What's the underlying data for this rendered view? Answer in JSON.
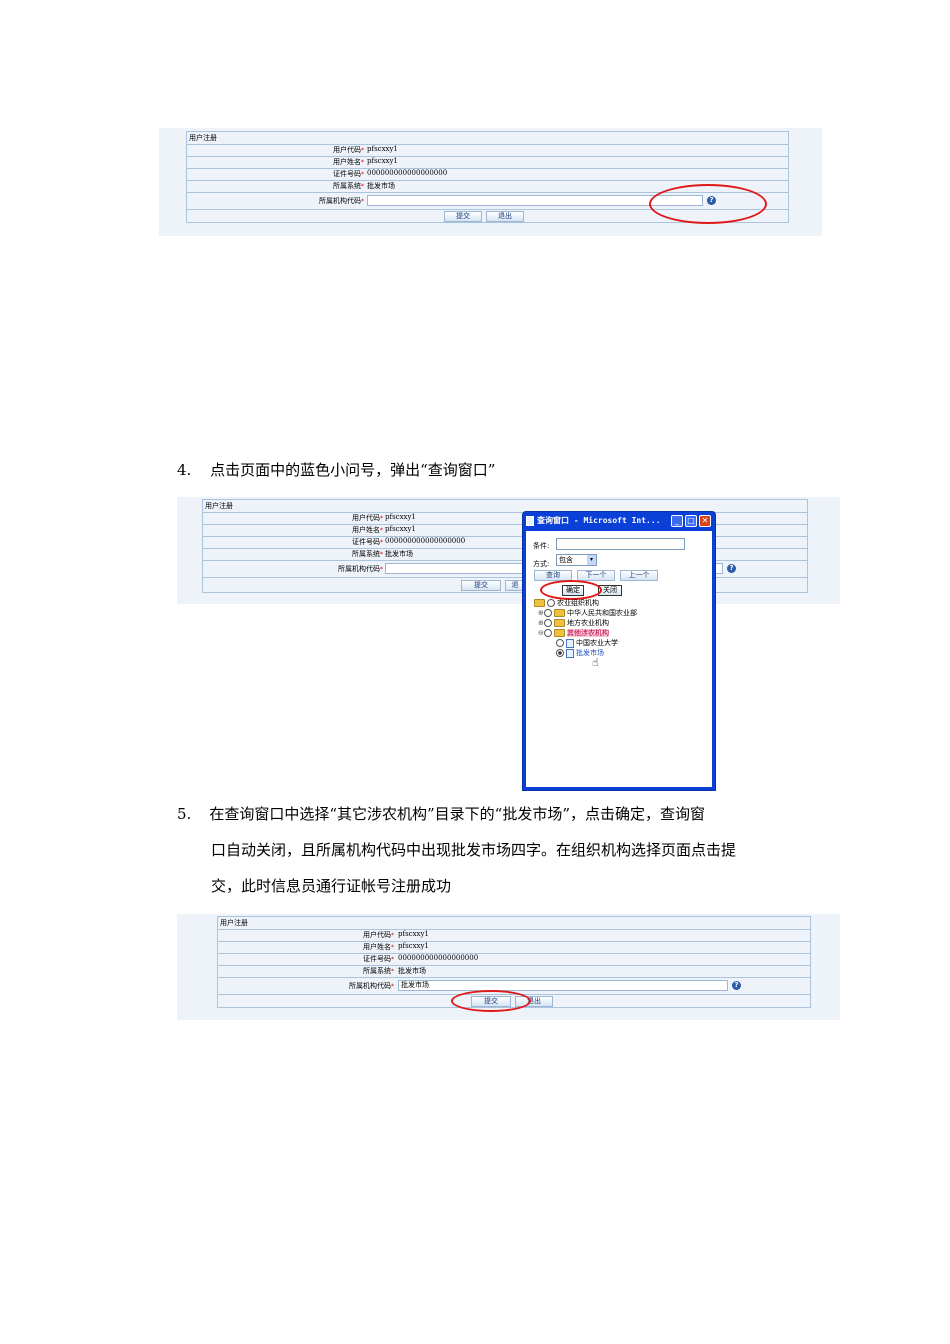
{
  "form1": {
    "title": "用户注册",
    "fields": [
      {
        "label": "用户代码",
        "value": "pfscxxy1"
      },
      {
        "label": "用户姓名",
        "value": "pfscxxy1"
      },
      {
        "label": "证件号码",
        "value": "000000000000000000"
      },
      {
        "label": "所属系统",
        "value": "批发市场"
      },
      {
        "label": "所属机构代码",
        "value": ""
      }
    ],
    "required_mark": "*",
    "help_icon": "?",
    "submit": "提交",
    "exit": "退出"
  },
  "step4": {
    "number": "4.",
    "text": "点击页面中的蓝色小问号，弹出“查询窗口”"
  },
  "form2": {
    "title": "用户注册",
    "fields": [
      {
        "label": "用户代码",
        "value": "pfscxxy1"
      },
      {
        "label": "用户姓名",
        "value": "pfscxxy1"
      },
      {
        "label": "证件号码",
        "value": "000000000000000000"
      },
      {
        "label": "所属系统",
        "value": "批发市场"
      },
      {
        "label": "所属机构代码",
        "value": ""
      }
    ],
    "submit": "提交",
    "exit": "退"
  },
  "popup": {
    "title": "查询窗口 - Microsoft Int...",
    "condition_label": "条件:",
    "method_label": "方式:",
    "method_value": "包含",
    "query": "查询",
    "next": "下一个",
    "prev": "上一个",
    "ok": "确定",
    "close": "关闭",
    "tree": {
      "root": "农业组织机构",
      "n1": "中华人民共和国农业部",
      "n2": "地方农业机构",
      "n3": "其他涉农机构",
      "n3a": "中国农业大学",
      "n3b": "批发市场"
    }
  },
  "step5": {
    "number": "5.",
    "line1": "在查询窗口中选择“其它涉农机构”目录下的“批发市场”，点击确定，查询窗",
    "line2": "口自动关闭，且所属机构代码中出现批发市场四字。在组织机构选择页面点击提",
    "line3": "交，此时信息员通行证帐号注册成功"
  },
  "form3": {
    "title": "用户注册",
    "fields": [
      {
        "label": "用户代码",
        "value": "pfscxxy1"
      },
      {
        "label": "用户姓名",
        "value": "pfscxxy1"
      },
      {
        "label": "证件号码",
        "value": "000000000000000000"
      },
      {
        "label": "所属系统",
        "value": "批发市场"
      },
      {
        "label": "所属机构代码",
        "value": "批发市场"
      }
    ],
    "submit": "提交",
    "exit": "退出"
  },
  "colors": {
    "highlight_ring": "#e01818",
    "form_border": "#aac4df",
    "popup_blue": "#0a3fd8"
  }
}
